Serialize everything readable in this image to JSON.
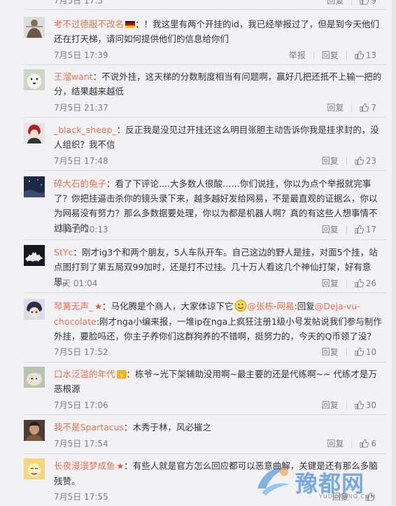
{
  "comments": [
    {
      "user": "",
      "text": "",
      "time": "7月5日 17:5",
      "reply": "回复",
      "likes": "9",
      "report": ""
    },
    {
      "user": "考不过德服不改名",
      "text": "：！我这里有两个开挂的id，我已经举报过了，但是到今天他们还在打天梯，请问如何提供他们的信息给你们",
      "time": "7月5日 17:39",
      "reply": "回复",
      "likes": "13",
      "report": "举报"
    },
    {
      "user": "王溜want",
      "text": "：不说外挂，这天梯的分数制度相当有问题啊，赢好几把还抵不上输一把的分，结果越来越低",
      "time": "7月5日 21:37",
      "reply": "回复",
      "likes": "7",
      "report": ""
    },
    {
      "user": "_black_sheep_",
      "text": "：反正我是没见过开挂还这么明目张胆主动告诉你我是挂求封的，没人组织？我不信",
      "time": "7月5日 17:48",
      "reply": "回复",
      "likes": "23",
      "report": ""
    },
    {
      "user": "碎大石的兔子",
      "text": "：看了下评论....大多数人很酸……你们说挂，你以为点个举报就完事了？你把挂逼击杀你的镜头录下来，越多越好发给网易，不是最直观的证据么，你以为网易没有努力？那么多数据要处理，你以为都是机器人啊？真的有这些人想事情不过脑子的.",
      "time": "7月5日 20:13",
      "reply": "回复",
      "likes": "17",
      "report": ""
    },
    {
      "user": "StYc",
      "text": "：刚才ig3个和两个朋友，5人车队开车。自己这边的野人是挂，对面5个挂，站点图打到了第五局双99加时，还是打不过挂。几十万人看这几个神仙打架，好有意思。",
      "time": "今天 01:04",
      "reply": "回复",
      "likes": "26",
      "report": ""
    },
    {
      "user": "琴篝无声_",
      "text_a": "：马化腾是个商人，大家体谅下它",
      "mention1": "@张栋-网易",
      "text_b": ":回复",
      "mention2": "@Deja-vu-chocolate",
      "text_c": ":刚才nga小编来报，一堆ip在nga上疯狂注册1级小号发帖说我们参与制作外挂，要脸吗还，你主子养你们这群狗养的不错啊，挺努力的，今天的Q币领了没？",
      "time": "7月5日 17:52",
      "reply": "回复",
      "likes": "10",
      "report": ""
    },
    {
      "user": "口水泛滥的年代",
      "text": "：栋爷~光下架辅助没用啊~最主要的还是代练啊~~ 代练才是万恶根源",
      "time": "7月5日 17:06",
      "reply": "回复",
      "likes": "30",
      "report": ""
    },
    {
      "user": "我不是Spartacus",
      "text": "：木秀于林，风必摧之",
      "time": "7月5日 17:54",
      "reply": "回复",
      "likes": "6",
      "report": ""
    },
    {
      "user": "长夜漫漫梦成鱼",
      "text": "：有些人就是官方怎么回应都可以恶意曲解，关键是还有那么多脑残赞。",
      "time": "7月5日 17:55",
      "reply": "回复",
      "likes": "",
      "report": ""
    }
  ],
  "watermark": {
    "brand": "豫都网",
    "url": "YUDUWANG.COM"
  },
  "colors": {
    "username": "#eb7350",
    "meta": "#808080",
    "background": "#f2f2f5"
  }
}
